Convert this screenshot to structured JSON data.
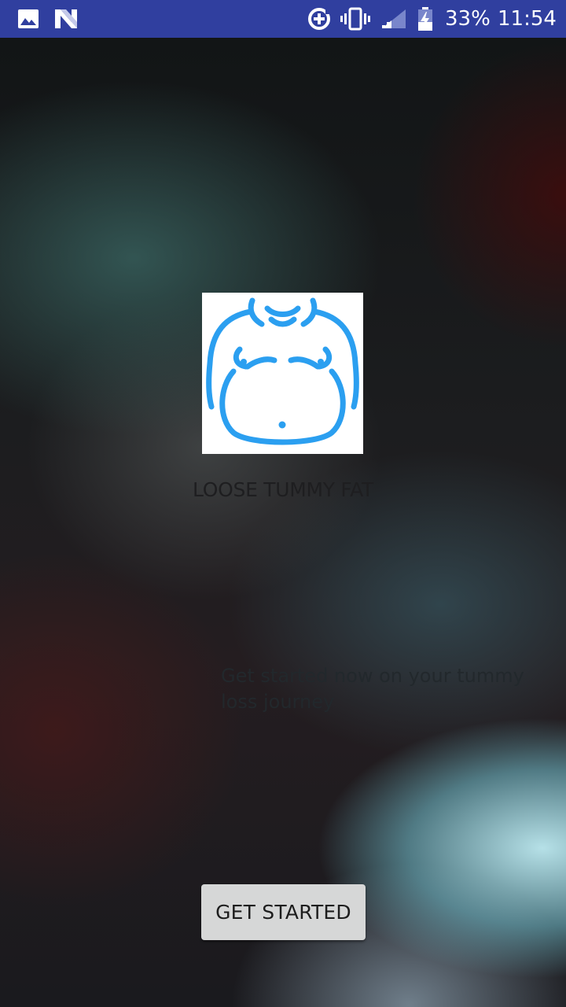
{
  "status_bar": {
    "battery_percent": "33%",
    "time": "11:54",
    "background_color": "#303f9f",
    "icons": [
      "image-icon",
      "n-logo-icon",
      "data-saver-icon",
      "vibrate-icon",
      "signal-icon",
      "battery-charging-icon"
    ]
  },
  "main": {
    "logo": {
      "icon": "belly-icon",
      "color": "#2b9ff0"
    },
    "title": "LOOSE TUMMY FAT",
    "tagline": "Get started now on your tummy loss journey",
    "button_label": "GET STARTED"
  }
}
